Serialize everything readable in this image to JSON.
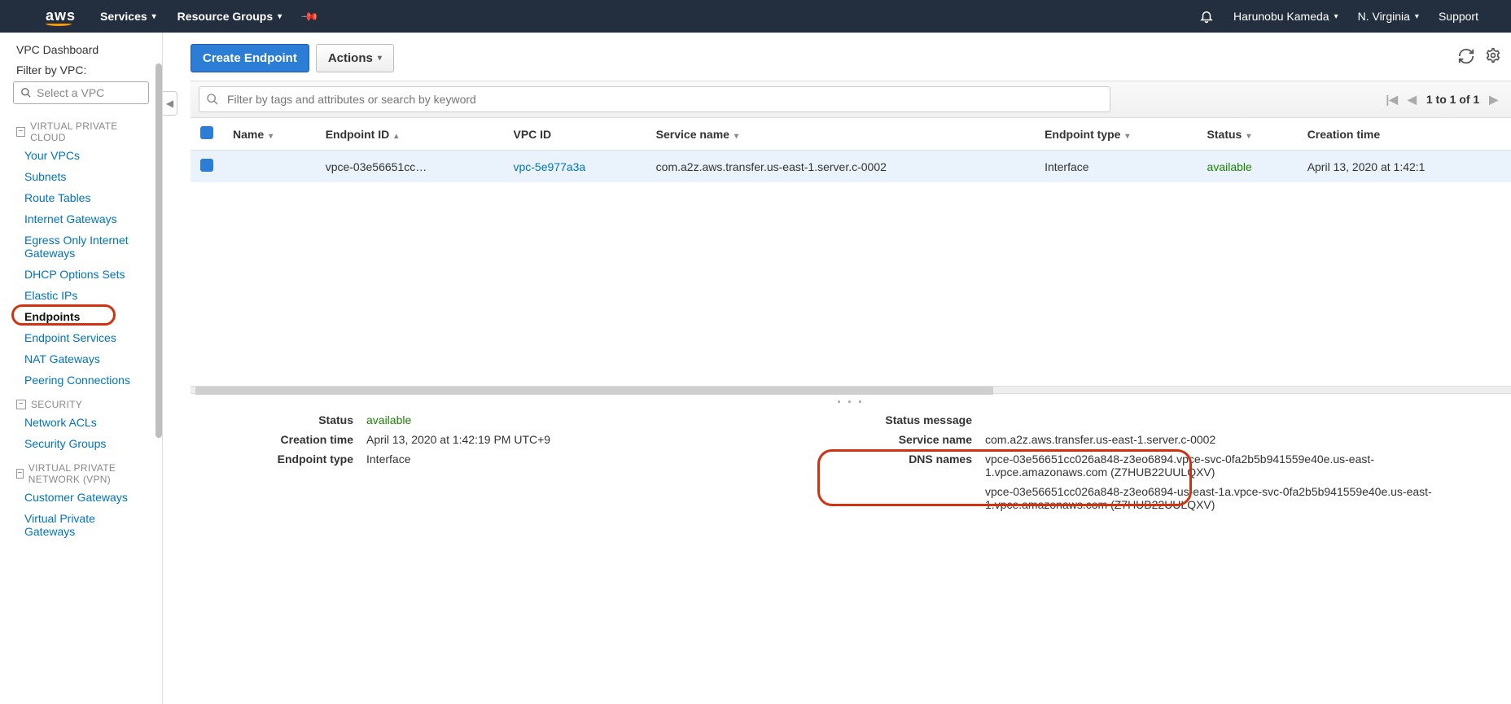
{
  "nav": {
    "logo": "aws",
    "services": "Services",
    "resourceGroups": "Resource Groups",
    "user": "Harunobu Kameda",
    "region": "N. Virginia",
    "support": "Support"
  },
  "sidebar": {
    "dashboard": "VPC Dashboard",
    "filterLabel": "Filter by VPC:",
    "filterPlaceholder": "Select a VPC",
    "sections": {
      "vpc": {
        "title": "VIRTUAL PRIVATE CLOUD",
        "items": [
          "Your VPCs",
          "Subnets",
          "Route Tables",
          "Internet Gateways",
          "Egress Only Internet Gateways",
          "DHCP Options Sets",
          "Elastic IPs",
          "Endpoints",
          "Endpoint Services",
          "NAT Gateways",
          "Peering Connections"
        ]
      },
      "security": {
        "title": "SECURITY",
        "items": [
          "Network ACLs",
          "Security Groups"
        ]
      },
      "vpn": {
        "title": "VIRTUAL PRIVATE NETWORK (VPN)",
        "items": [
          "Customer Gateways",
          "Virtual Private Gateways"
        ]
      }
    },
    "activeItem": "Endpoints"
  },
  "actions": {
    "create": "Create Endpoint",
    "actions": "Actions"
  },
  "filter": {
    "placeholder": "Filter by tags and attributes or search by keyword",
    "range": "1 to 1 of 1"
  },
  "table": {
    "headers": {
      "name": "Name",
      "endpointId": "Endpoint ID",
      "vpcId": "VPC ID",
      "serviceName": "Service name",
      "endpointType": "Endpoint type",
      "status": "Status",
      "creationTime": "Creation time"
    },
    "rows": [
      {
        "name": "",
        "endpointId": "vpce-03e56651cc…",
        "vpcId": "vpc-5e977a3a",
        "serviceName": "com.a2z.aws.transfer.us-east-1.server.c-0002",
        "endpointType": "Interface",
        "status": "available",
        "creationTime": "April 13, 2020 at 1:42:1"
      }
    ]
  },
  "details": {
    "left": {
      "statusLabel": "Status",
      "status": "available",
      "creationLabel": "Creation time",
      "creation": "April 13, 2020 at 1:42:19 PM UTC+9",
      "typeLabel": "Endpoint type",
      "type": "Interface"
    },
    "right": {
      "statusMsgLabel": "Status message",
      "statusMsg": "",
      "serviceLabel": "Service name",
      "service": "com.a2z.aws.transfer.us-east-1.server.c-0002",
      "dnsLabel": "DNS names",
      "dns1": "vpce-03e56651cc026a848-z3eo6894.vpce-svc-0fa2b5b941559e40e.us-east-1.vpce.amazonaws.com (Z7HUB22UULQXV)",
      "dns2": "vpce-03e56651cc026a848-z3eo6894-us-east-1a.vpce-svc-0fa2b5b941559e40e.us-east-1.vpce.amazonaws.com (Z7HUB22UULQXV)"
    }
  }
}
